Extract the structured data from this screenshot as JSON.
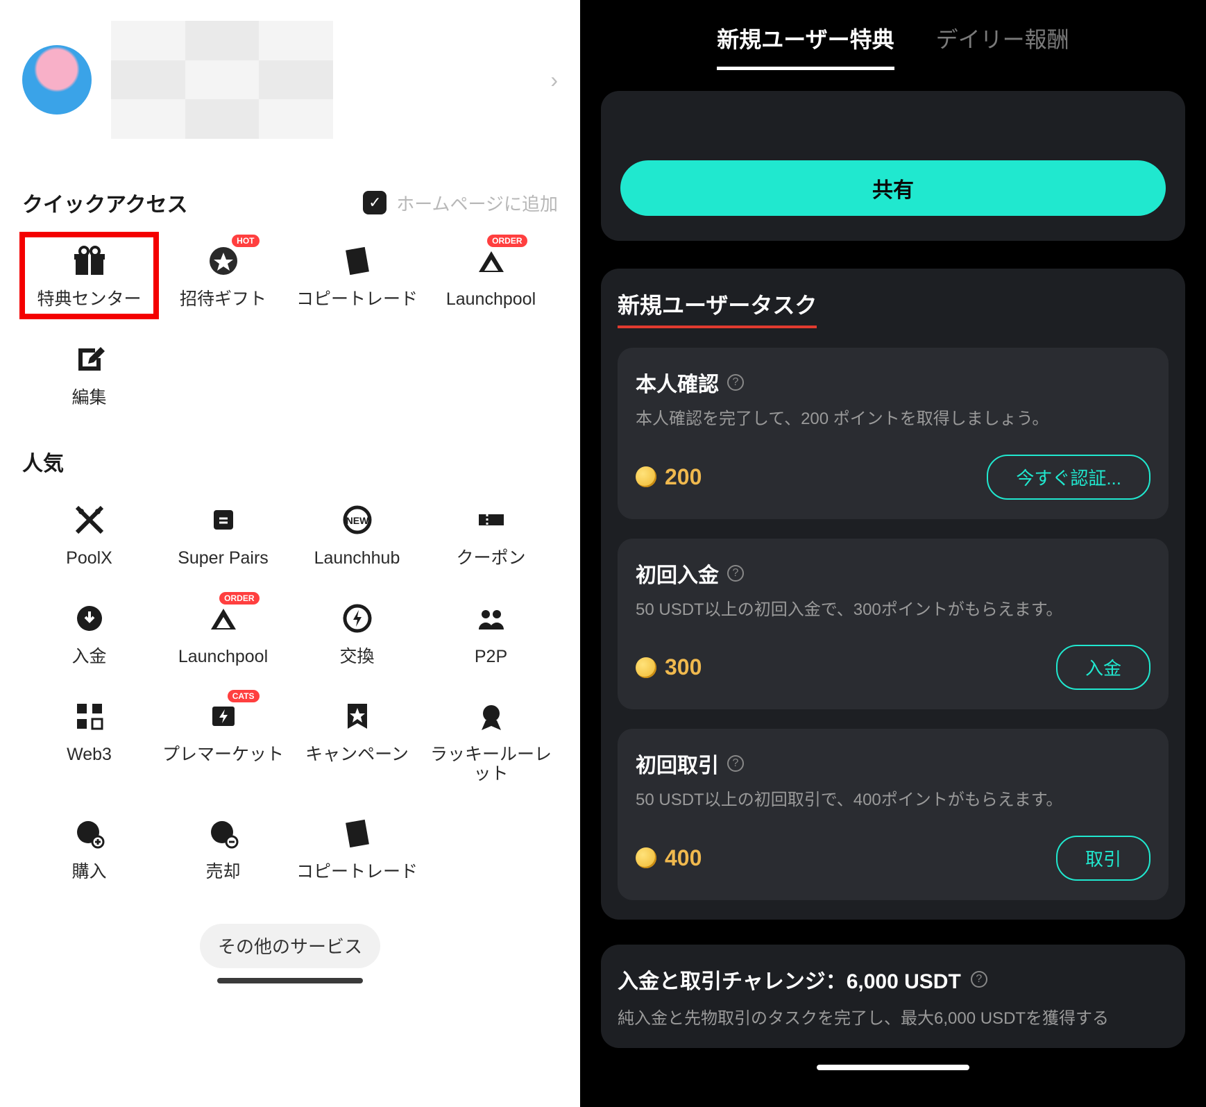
{
  "left": {
    "quick_access_title": "クイックアクセス",
    "add_to_home_label": "ホームページに追加",
    "quick_items": [
      {
        "label": "特典センター",
        "icon": "gift",
        "badge": null,
        "highlighted": true
      },
      {
        "label": "招待ギフト",
        "icon": "star-badge",
        "badge": "HOT",
        "highlighted": false
      },
      {
        "label": "コピートレード",
        "icon": "book",
        "badge": null,
        "highlighted": false
      },
      {
        "label": "Launchpool",
        "icon": "triangle",
        "badge": "ORDER",
        "highlighted": false
      },
      {
        "label": "編集",
        "icon": "edit",
        "badge": null,
        "highlighted": false
      }
    ],
    "popular_title": "人気",
    "popular_items": [
      {
        "label": "PoolX",
        "icon": "axes",
        "badge": null
      },
      {
        "label": "Super Pairs",
        "icon": "swap-card",
        "badge": null
      },
      {
        "label": "Launchhub",
        "icon": "new-ring",
        "badge": null
      },
      {
        "label": "クーポン",
        "icon": "ticket",
        "badge": null
      },
      {
        "label": "入金",
        "icon": "circle-dl",
        "badge": null
      },
      {
        "label": "Launchpool",
        "icon": "triangle",
        "badge": "ORDER"
      },
      {
        "label": "交換",
        "icon": "bolt-ring",
        "badge": null
      },
      {
        "label": "P2P",
        "icon": "people",
        "badge": null
      },
      {
        "label": "Web3",
        "icon": "squares",
        "badge": null
      },
      {
        "label": "プレマーケット",
        "icon": "bolt-card",
        "badge": "CATS"
      },
      {
        "label": "キャンペーン",
        "icon": "star-flag",
        "badge": null
      },
      {
        "label": "ラッキールーレット",
        "icon": "medal",
        "badge": null
      },
      {
        "label": "購入",
        "icon": "coin-plus",
        "badge": null
      },
      {
        "label": "売却",
        "icon": "coin-minus",
        "badge": null
      },
      {
        "label": "コピートレード",
        "icon": "book",
        "badge": null
      }
    ],
    "more_button": "その他のサービス"
  },
  "right": {
    "tabs": {
      "active": "新規ユーザー特典",
      "inactive": "デイリー報酬"
    },
    "share_button": "共有",
    "task_block_title": "新規ユーザータスク",
    "tasks": [
      {
        "title": "本人確認",
        "desc": "本人確認を完了して、200 ポイントを取得しましょう。",
        "points": "200",
        "action": "今すぐ認証..."
      },
      {
        "title": "初回入金",
        "desc": "50 USDT以上の初回入金で、300ポイントがもらえます。",
        "points": "300",
        "action": "入金"
      },
      {
        "title": "初回取引",
        "desc": "50 USDT以上の初回取引で、400ポイントがもらえます。",
        "points": "400",
        "action": "取引"
      }
    ],
    "challenge": {
      "title": "入金と取引チャレンジ：6,000 USDT",
      "desc": "純入金と先物取引のタスクを完了し、最大6,000 USDTを獲得する"
    }
  }
}
